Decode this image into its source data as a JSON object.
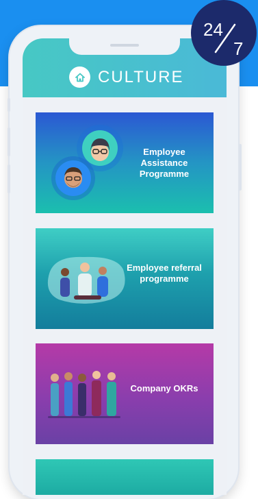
{
  "header": {
    "title": "CULTURE",
    "home_icon": "home-icon"
  },
  "badge": {
    "top": "24",
    "bottom": "7"
  },
  "cards": [
    {
      "label": "Employee Assistance Programme",
      "illustration": "avatar-pair"
    },
    {
      "label": "Employee referral programme",
      "illustration": "team-group"
    },
    {
      "label": "Company OKRs",
      "illustration": "team-line"
    }
  ],
  "colors": {
    "accent_blue": "#1a8ff0",
    "header_teal": "#47c8c4",
    "badge_navy": "#1c2a6b"
  }
}
